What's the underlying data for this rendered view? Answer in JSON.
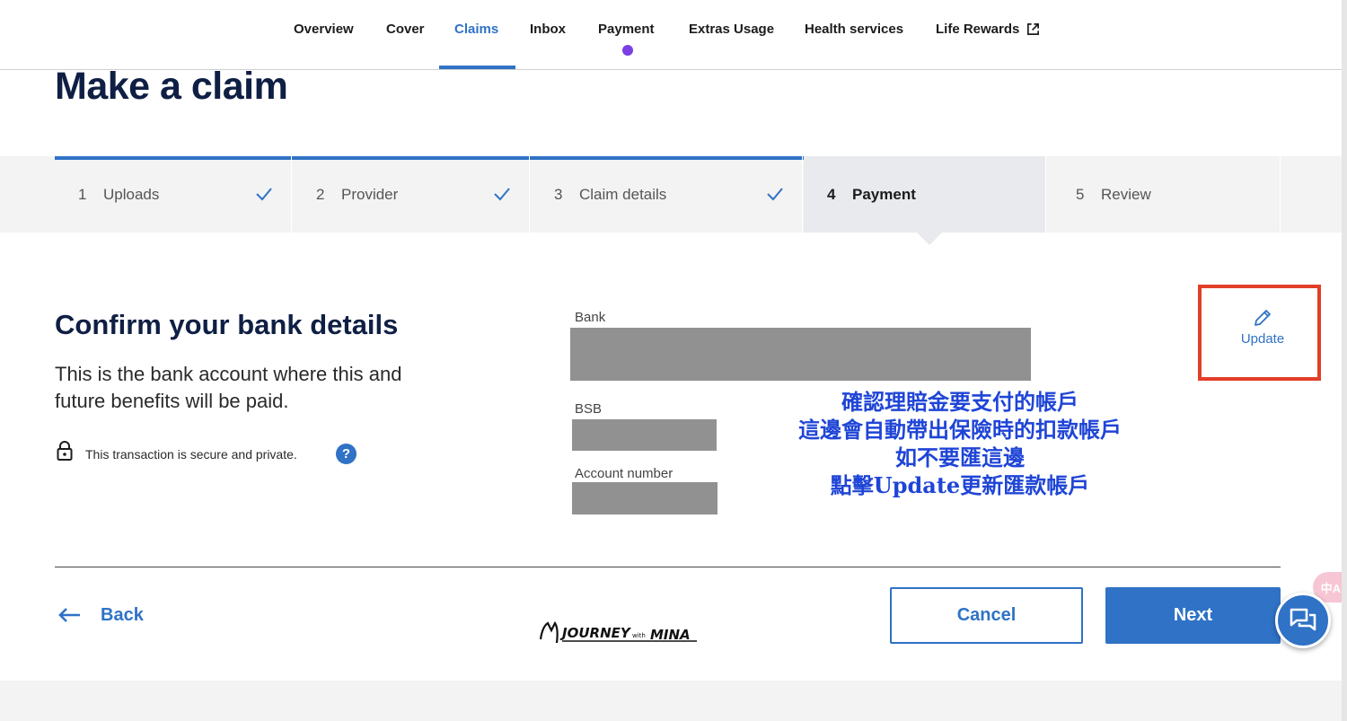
{
  "nav": {
    "items": [
      {
        "label": "Overview"
      },
      {
        "label": "Cover"
      },
      {
        "label": "Claims"
      },
      {
        "label": "Inbox"
      },
      {
        "label": "Payment"
      },
      {
        "label": "Extras Usage"
      },
      {
        "label": "Health services"
      },
      {
        "label": "Life Rewards"
      }
    ],
    "active": "Claims"
  },
  "page_title": "Make a claim",
  "stepper": {
    "steps": [
      {
        "num": "1",
        "label": "Uploads",
        "status": "complete"
      },
      {
        "num": "2",
        "label": "Provider",
        "status": "complete"
      },
      {
        "num": "3",
        "label": "Claim details",
        "status": "complete"
      },
      {
        "num": "4",
        "label": "Payment",
        "status": "active"
      },
      {
        "num": "5",
        "label": "Review",
        "status": "pending"
      }
    ]
  },
  "section": {
    "title": "Confirm your bank details",
    "description": "This is the bank account where this and future benefits will be paid.",
    "secure_text": "This transaction is secure and private.",
    "help_glyph": "?"
  },
  "fields": {
    "bank_label": "Bank",
    "bsb_label": "BSB",
    "account_label": "Account number"
  },
  "update": {
    "label": "Update"
  },
  "annotation": {
    "lines": [
      "確認理賠金要支付的帳戶",
      "這邊會自動帶出保險時的扣款帳戶",
      "如不要匯這邊",
      "點擊Update更新匯款帳戶"
    ]
  },
  "actions": {
    "back_label": "Back",
    "cancel_label": "Cancel",
    "next_label": "Next"
  },
  "translate_glyph": "中A",
  "watermark": "JOURNEY with MINA",
  "colors": {
    "accent": "#2f72c6",
    "heading": "#0f1f44",
    "highlight_box": "#e23e28",
    "annotation_text": "#1f45d6",
    "notification_dot": "#7b3fe4",
    "redaction": "#919191"
  }
}
